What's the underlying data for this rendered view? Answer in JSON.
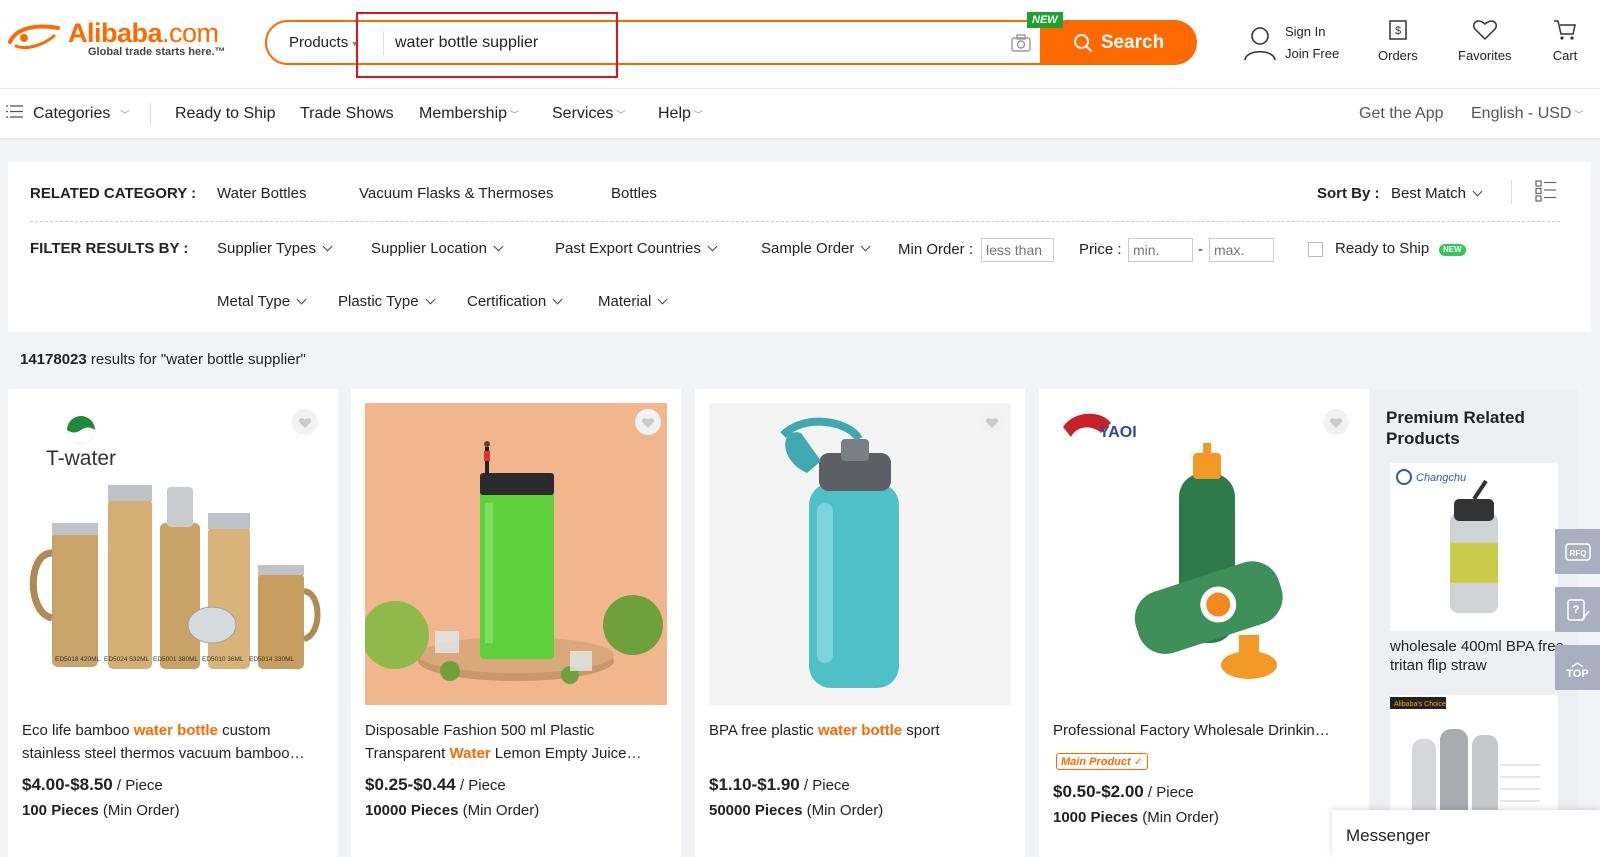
{
  "header": {
    "logo_text": "Alibaba",
    "logo_suffix": ".com",
    "tagline": "Global trade starts here.™",
    "search": {
      "category": "Products",
      "query": "water bottle supplier",
      "button_label": "Search",
      "new_badge": "NEW"
    },
    "sign_in": "Sign In",
    "join_free": "Join Free",
    "orders": "Orders",
    "favorites": "Favorites",
    "cart": "Cart"
  },
  "nav": {
    "categories": "Categories",
    "items": [
      "Ready to Ship",
      "Trade Shows",
      "Membership",
      "Services",
      "Help"
    ],
    "get_app": "Get the App",
    "language": "English - USD"
  },
  "filters": {
    "related_label": "RELATED CATEGORY :",
    "related": [
      "Water Bottles",
      "Vacuum Flasks & Thermoses",
      "Bottles"
    ],
    "sort_label": "Sort By :",
    "sort_value": "Best Match",
    "filter_label": "FILTER RESULTS BY :",
    "row1": [
      "Supplier Types",
      "Supplier Location",
      "Past Export Countries",
      "Sample Order"
    ],
    "min_order_label": "Min Order :",
    "min_order_placeholder": "less than",
    "price_label": "Price :",
    "price_min_placeholder": "min.",
    "price_sep": "-",
    "price_max_placeholder": "max.",
    "ready_to_ship": "Ready to Ship",
    "new_pill": "NEW",
    "row2": [
      "Metal Type",
      "Plastic Type",
      "Certification",
      "Material"
    ]
  },
  "results": {
    "count": "14178023",
    "text": " results for \"water bottle supplier\""
  },
  "products": [
    {
      "brand": "T-water",
      "title_pre": "Eco life bamboo ",
      "title_hl": "water bottle",
      "title_post": " custom stainless steel thermos vacuum bamboo…",
      "price": "$4.00-$8.50",
      "unit": " / Piece",
      "moq": "100 Pieces",
      "moq_suffix": " (Min Order)",
      "image_labels": [
        "ED5018 420ML",
        "ED5024 532ML",
        "ED5001 380ML",
        "ED5010 36ML",
        "ED5014 330ML"
      ]
    },
    {
      "title_pre": "Disposable Fashion 500 ml Plastic Transparent ",
      "title_hl": "Water",
      "title_post": " Lemon Empty Juice…",
      "price": "$0.25-$0.44",
      "unit": " / Piece",
      "moq": "10000 Pieces",
      "moq_suffix": " (Min Order)"
    },
    {
      "title_pre": "BPA free plastic ",
      "title_hl": "water bottle",
      "title_post": " sport",
      "price": "$1.10-$1.90",
      "unit": " / Piece",
      "moq": "50000 Pieces",
      "moq_suffix": " (Min Order)"
    },
    {
      "title_pre": "Professional Factory Wholesale Drinkin…",
      "title_hl": "",
      "title_post": "",
      "main_product_badge": "Main Product",
      "price": "$0.50-$2.00",
      "unit": " / Piece",
      "moq": "1000 Pieces",
      "moq_suffix": " (Min Order)"
    }
  ],
  "premium": {
    "title": "Premium Related Products",
    "brand": "Changchu",
    "item_text": "wholesale 400ml BPA free tritan flip straw",
    "choice_badge": "Alibaba's Choice"
  },
  "floating": {
    "rfq": "RFQ",
    "top": "TOP"
  },
  "messenger": "Messenger",
  "colors": {
    "brand_orange": "#ff6a00",
    "highlight_red": "#e0151b",
    "new_green": "#1aa32f"
  }
}
